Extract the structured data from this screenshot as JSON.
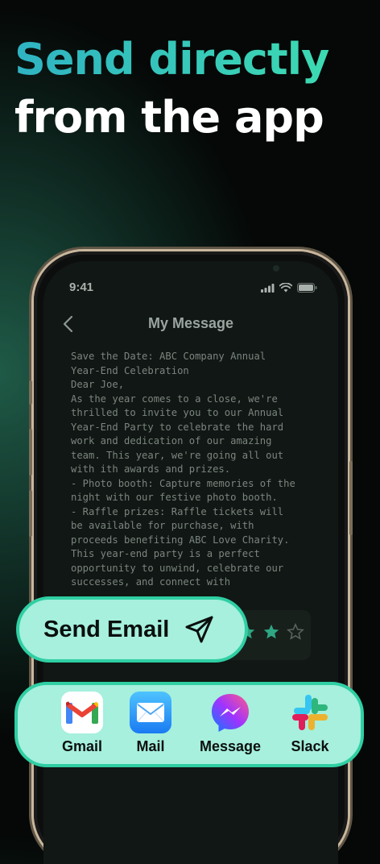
{
  "headline": {
    "line1": "Send directly",
    "line2": "from the app"
  },
  "status_bar": {
    "time": "9:41",
    "icons": [
      "signal-icon",
      "wifi-icon",
      "battery-icon"
    ]
  },
  "screen": {
    "title": "My Message",
    "back_icon": "chevron-left-icon",
    "message_text": "Save the Date: ABC Company Annual\nYear-End Celebration\nDear Joe,\nAs the year comes to a close, we're\nthrilled to invite you to our Annual\nYear-End Party to celebrate the hard\nwork and dedication of our amazing\nteam. This year, we're going all out\nwith ith awards and prizes.\n- Photo booth: Capture memories of the\nnight with our festive photo booth.\n- Raffle prizes: Raffle tickets will\nbe available for purchase, with\nproceeds benefiting ABC Love Charity.\nThis year-end party is a perfect\nopportunity to unwind, celebrate our\nsuccesses, and connect with",
    "rating": {
      "value": 4,
      "max": 5
    }
  },
  "send_button": {
    "label": "Send Email",
    "icon": "paper-plane-icon"
  },
  "share_apps": [
    {
      "name": "Gmail",
      "icon": "gmail-icon"
    },
    {
      "name": "Mail",
      "icon": "mail-icon"
    },
    {
      "name": "Message",
      "icon": "messenger-icon"
    },
    {
      "name": "Slack",
      "icon": "slack-icon"
    }
  ],
  "colors": {
    "accent_teal": "#2fcfa3",
    "pill_bg": "#a6f0dd",
    "headline_gradient_start": "#2fb3c2",
    "headline_gradient_end": "#3fe0b0"
  }
}
